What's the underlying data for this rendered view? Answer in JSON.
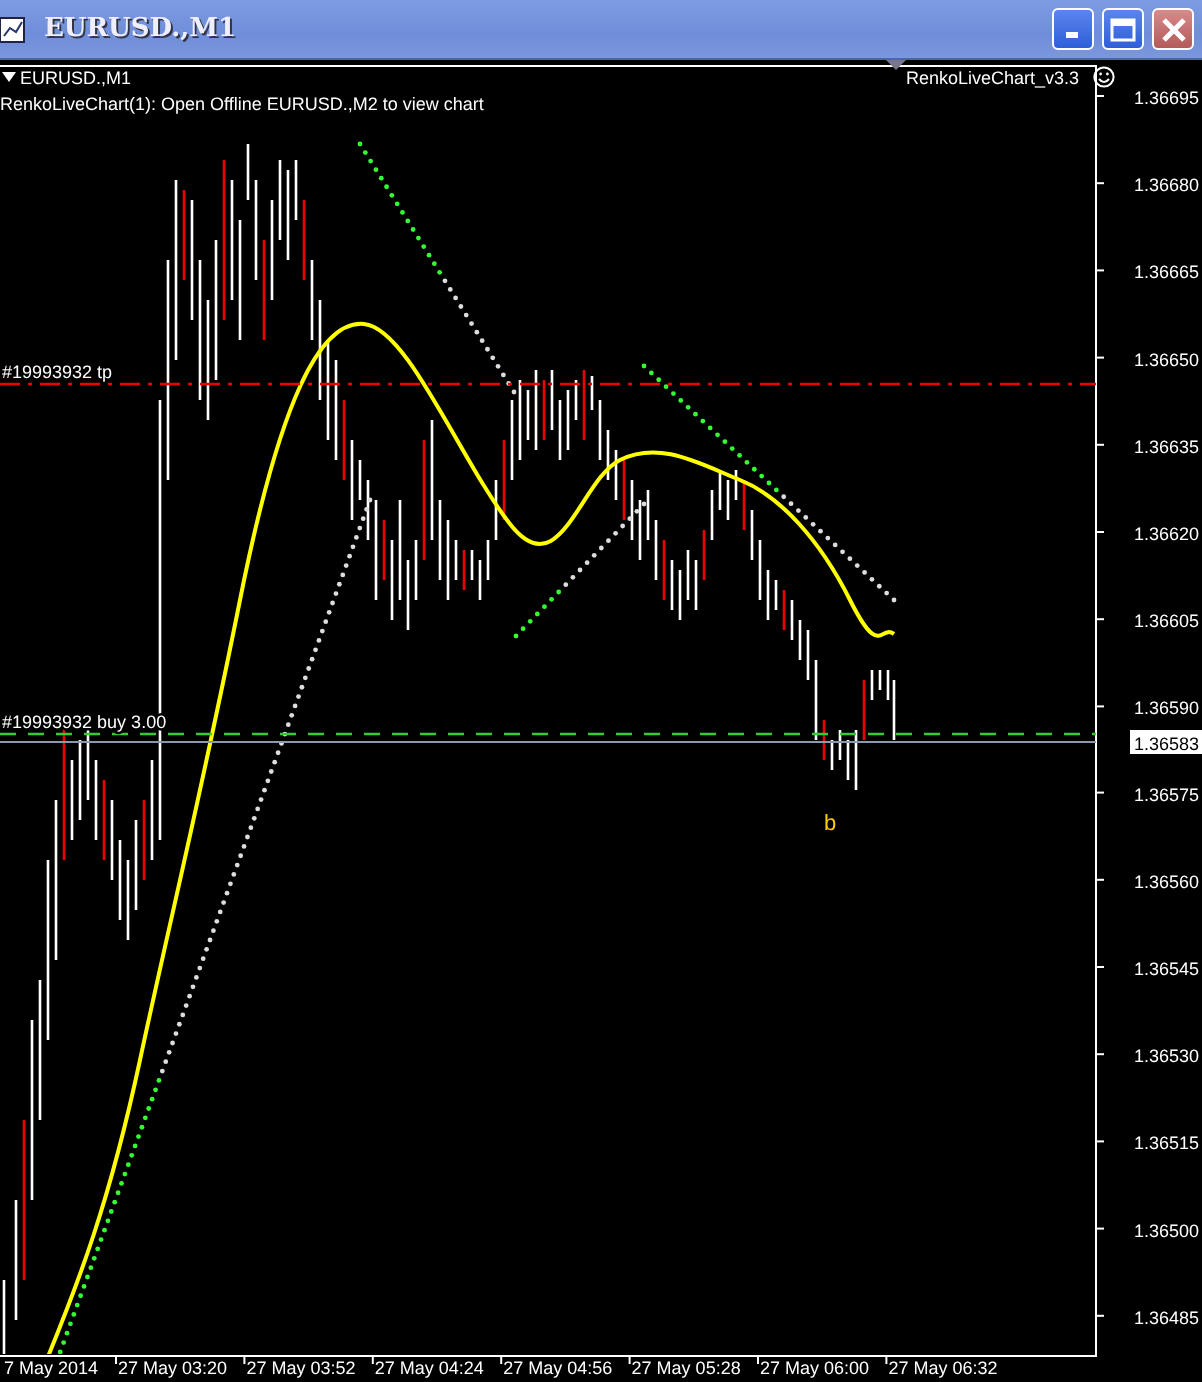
{
  "window": {
    "title": "EURUSD.,M1"
  },
  "chart": {
    "symbol_label": "EURUSD.,M1",
    "info_text": "RenkoLiveChart(1): Open Offline EURUSD.,M2 to view chart",
    "indicator_name": "RenkoLiveChart_v3.3",
    "order_lines": [
      {
        "kind": "take-profit",
        "label": "#19993932 tp"
      },
      {
        "kind": "entry",
        "label": "#19993932 buy 3.00"
      }
    ],
    "trade_marker": "b",
    "price_axis": [
      "1.36695",
      "1.36680",
      "1.36665",
      "1.36650",
      "1.36635",
      "1.36620",
      "1.36605",
      "1.36590",
      "1.36575",
      "1.36560",
      "1.36545",
      "1.36530",
      "1.36515",
      "1.36500",
      "1.36485"
    ],
    "bid_price": "1.36583",
    "time_axis": [
      "7 May 2014",
      "27 May 03:20",
      "27 May 03:52",
      "27 May 04:24",
      "27 May 04:56",
      "27 May 05:28",
      "27 May 06:00",
      "27 May 06:32"
    ]
  }
}
